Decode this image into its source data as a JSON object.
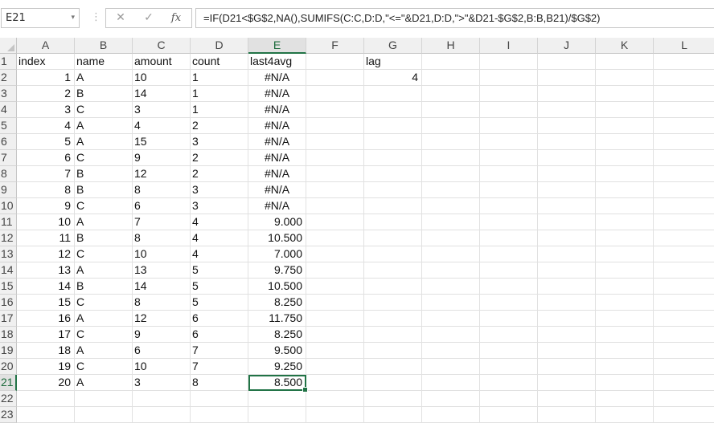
{
  "formula_bar": {
    "name_box": "E21",
    "dropdown_glyph": "▾",
    "separator_glyph": "⋮",
    "cancel_glyph": "✕",
    "enter_glyph": "✓",
    "fx_label": "fx",
    "formula": "=IF(D21<$G$2,NA(),SUMIFS(C:C,D:D,\"<=\"&D21,D:D,\">\"&D21-$G$2,B:B,B21)/$G$2)"
  },
  "columns": [
    "A",
    "B",
    "C",
    "D",
    "E",
    "F",
    "G",
    "H",
    "I",
    "J",
    "K",
    "L"
  ],
  "selected_column": "E",
  "selected_row": 21,
  "row_count": 23,
  "cells": {
    "A1": "index",
    "B1": "name",
    "C1": "amount",
    "D1": "count",
    "E1": "last4avg",
    "G1": "lag",
    "G2": "4",
    "A2": "1",
    "B2": "A",
    "C2": "10",
    "D2": "1",
    "E2": "#N/A",
    "A3": "2",
    "B3": "B",
    "C3": "14",
    "D3": "1",
    "E3": "#N/A",
    "A4": "3",
    "B4": "C",
    "C4": "3",
    "D4": "1",
    "E4": "#N/A",
    "A5": "4",
    "B5": "A",
    "C5": "4",
    "D5": "2",
    "E5": "#N/A",
    "A6": "5",
    "B6": "A",
    "C6": "15",
    "D6": "3",
    "E6": "#N/A",
    "A7": "6",
    "B7": "C",
    "C7": "9",
    "D7": "2",
    "E7": "#N/A",
    "A8": "7",
    "B8": "B",
    "C8": "12",
    "D8": "2",
    "E8": "#N/A",
    "A9": "8",
    "B9": "B",
    "C9": "8",
    "D9": "3",
    "E9": "#N/A",
    "A10": "9",
    "B10": "C",
    "C10": "6",
    "D10": "3",
    "E10": "#N/A",
    "A11": "10",
    "B11": "A",
    "C11": "7",
    "D11": "4",
    "E11": "9.000",
    "A12": "11",
    "B12": "B",
    "C12": "8",
    "D12": "4",
    "E12": "10.500",
    "A13": "12",
    "B13": "C",
    "C13": "10",
    "D13": "4",
    "E13": "7.000",
    "A14": "13",
    "B14": "A",
    "C14": "13",
    "D14": "5",
    "E14": "9.750",
    "A15": "14",
    "B15": "B",
    "C15": "14",
    "D15": "5",
    "E15": "10.500",
    "A16": "15",
    "B16": "C",
    "C16": "8",
    "D16": "5",
    "E16": "8.250",
    "A17": "16",
    "B17": "A",
    "C17": "12",
    "D17": "6",
    "E17": "11.750",
    "A18": "17",
    "B18": "C",
    "C18": "9",
    "D18": "6",
    "E18": "8.250",
    "A19": "18",
    "B19": "A",
    "C19": "6",
    "D19": "7",
    "E19": "9.500",
    "A20": "19",
    "B20": "C",
    "C20": "10",
    "D20": "7",
    "E20": "9.250",
    "A21": "20",
    "B21": "A",
    "C21": "3",
    "D21": "8",
    "E21": "8.500"
  },
  "alignment": {
    "right_columns": [
      "A",
      "G"
    ],
    "center_text": [
      "#N/A"
    ],
    "right_numeric_columns": [
      "E"
    ]
  },
  "colors": {
    "accent": "#217346",
    "header_bg": "#f0f0f0",
    "gridline": "#e1e1e1"
  }
}
